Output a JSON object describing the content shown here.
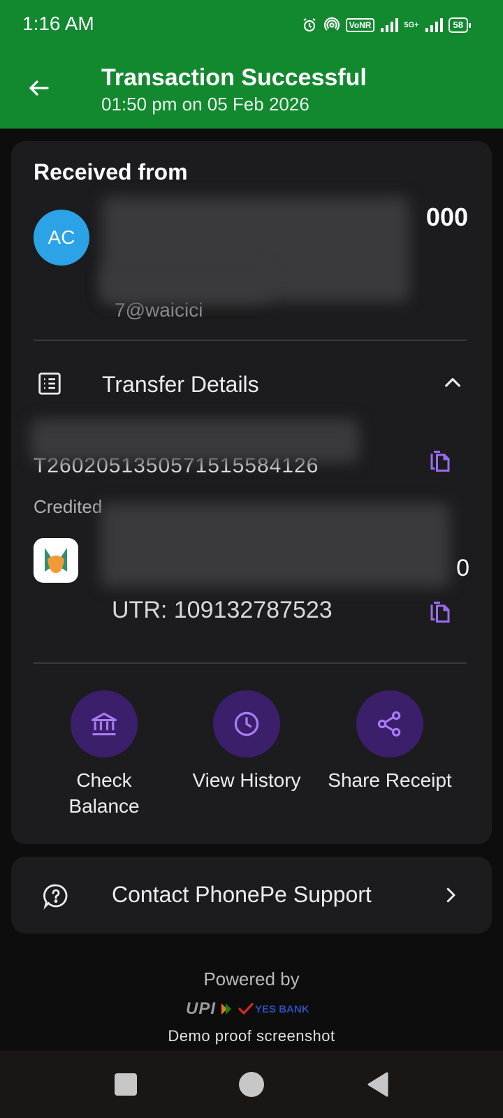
{
  "status_bar": {
    "time": "1:16 AM",
    "network_badge": "VoNR",
    "network_type": "5G+",
    "battery": "58"
  },
  "header": {
    "title": "Transaction Successful",
    "subtitle": "01:50 pm on 05 Feb 2026"
  },
  "received": {
    "section_title": "Received from",
    "avatar_initials": "AC",
    "amount": "000",
    "upi_fragment": "7@waicici"
  },
  "transfer_details": {
    "label": "Transfer Details",
    "transaction_id_partial": "T2602051350571515584126",
    "credited_label": "Credited",
    "credited_amount": "0",
    "utr": "UTR: 109132787523"
  },
  "actions": [
    {
      "label": "Check Balance",
      "icon": "bank-icon"
    },
    {
      "label": "View History",
      "icon": "clock-icon"
    },
    {
      "label": "Share Receipt",
      "icon": "share-icon"
    }
  ],
  "support": {
    "label": "Contact PhonePe Support"
  },
  "footer": {
    "powered_by": "Powered by",
    "upi_logo": "UPI",
    "bank_logo": "YES BANK",
    "demo_note": "Demo proof screenshot"
  },
  "colors": {
    "header_green": "#12892f",
    "card_bg": "#1c1c1e",
    "accent_purple": "#8b5cf6",
    "action_circle": "#3b1f6b",
    "avatar_blue": "#2ba3e6"
  }
}
